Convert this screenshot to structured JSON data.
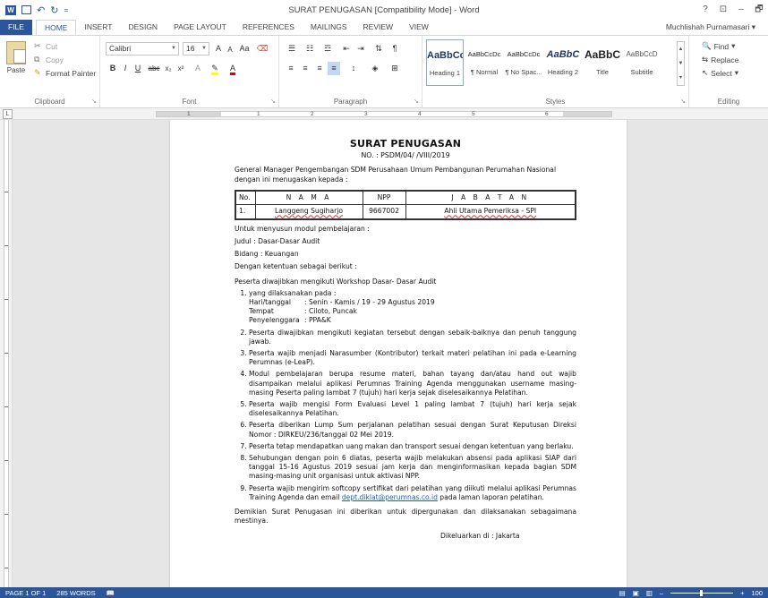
{
  "window": {
    "title": "SURAT PENUGASAN [Compatibility Mode] - Word",
    "help": "?",
    "controls": [
      "⊡",
      "–",
      "🗗"
    ]
  },
  "qat": {
    "word_icon": "W",
    "save_icon": "💾",
    "undo_icon": "↶",
    "redo_icon": "↻",
    "more": "="
  },
  "tabs": [
    "FILE",
    "HOME",
    "INSERT",
    "DESIGN",
    "PAGE LAYOUT",
    "REFERENCES",
    "MAILINGS",
    "REVIEW",
    "VIEW"
  ],
  "user": "Muchlishah Purnamasari",
  "ribbon": {
    "clipboard": {
      "label": "Clipboard",
      "paste": "Paste",
      "cut": "Cut",
      "copy": "Copy",
      "format_painter": "Format Painter"
    },
    "font": {
      "label": "Font",
      "font_name": "Calibri",
      "font_size": "16",
      "grow": "A",
      "shrink": "A",
      "case": "Aa"
    },
    "paragraph": {
      "label": "Paragraph"
    },
    "styles": {
      "label": "Styles",
      "items": [
        {
          "sample": "AaBbCc",
          "name": "Heading 1"
        },
        {
          "sample": "AaBbCcDc",
          "name": "¶ Normal"
        },
        {
          "sample": "AaBbCcDc",
          "name": "¶ No Spac..."
        },
        {
          "sample": "AaBbC",
          "name": "Heading 2"
        },
        {
          "sample": "AaBbC",
          "name": "Title"
        },
        {
          "sample": "AaBbCcD",
          "name": "Subtitle"
        }
      ]
    },
    "editing": {
      "label": "Editing",
      "find": "Find",
      "replace": "Replace",
      "select": "Select"
    }
  },
  "ruler": {
    "numbers": [
      "1",
      "1",
      "2",
      "3",
      "4",
      "5",
      "6"
    ]
  },
  "document": {
    "title": "SURAT PENUGASAN",
    "number": "NO.  :  PSDM/04/       /VIII/2019",
    "intro": "General Manager Pengembangan SDM Perusahaan Umum Pembangunan Perumahan Nasional dengan ini menugaskan kepada   :",
    "table": {
      "headers": [
        "No.",
        "N A M A",
        "NPP",
        "J A B A T A N"
      ],
      "rows": [
        [
          "1.",
          "Langgeng Sugiharjo",
          "9667002",
          "Ahli Utama Pemeriksa - SPI"
        ]
      ]
    },
    "purpose": "Untuk menyusun modul pembelajaran :",
    "judul": "Judul   : Dasar-Dasar Audit",
    "bidang": "Bidang  : Keuangan",
    "ketentuan": "Dengan ketentuan sebagai berikut :",
    "workshop": "Peserta diwajibkan mengikuti Workshop Dasar- Dasar Audit",
    "item1": {
      "lead": "yang dilaksanakan pada :",
      "hari_k": "Hari/tanggal",
      "hari_v": ": Senin - Kamis / 19 - 29 Agustus 2019",
      "tempat_k": "Tempat",
      "tempat_v": ": Ciloto, Puncak",
      "peny_k": "Penyelenggara",
      "peny_v": ": PPA&K"
    },
    "items": [
      "Peserta diwajibkan mengikuti kegiatan tersebut dengan sebaik-baiknya dan penuh tanggung jawab.",
      "Peserta wajib menjadi Narasumber (Kontributor) terkait materi pelatihan ini pada e-Learning Perumnas (e-LeaP).",
      "Modul pembelajaran berupa resume materi, bahan tayang dan/atau hand out wajib disampaikan melalui aplikasi Perumnas Training Agenda menggunakan username masing-masing Peserta paling lambat 7 (tujuh) hari kerja sejak diselesaikannya Pelatihan.",
      "Peserta wajib mengisi Form Evaluasi Level 1 paling lambat 7 (tujuh) hari kerja sejak diselesaikannya Pelatihan.",
      "Peserta diberikan Lump Sum perjalanan pelatihan sesuai dengan Surat Keputusan Direksi Nomor : DIRKEU/236/tanggal 02 Mei 2019.",
      "Peserta tetap mendapatkan uang makan dan transport sesuai dengan ketentuan yang berlaku.",
      "Sehubungan dengan poin 6 diatas, peserta wajib melakukan absensi pada aplikasi SIAP dari tanggal 15-16 Agustus 2019 sesuai jam kerja dan menginformasikan kepada bagian SDM masing-masing unit organisasi untuk aktivasi NPP."
    ],
    "item9": {
      "before": "Peserta wajib mengirim softcopy sertifikat dari pelatihan yang diikuti melalui aplikasi Perumnas Training Agenda dan email ",
      "email": "dept.diklat@perumnas.co.id",
      "after": " pada laman laporan pelatihan."
    },
    "closing": "Demikian Surat Penugasan ini diberikan untuk dipergunakan dan dilaksanakan sebagaimana mestinya.",
    "issued": "Dikeluarkan di   :   Jakarta"
  },
  "status": {
    "page": "PAGE 1 OF 1",
    "words": "285 WORDS",
    "zoom": "100"
  }
}
